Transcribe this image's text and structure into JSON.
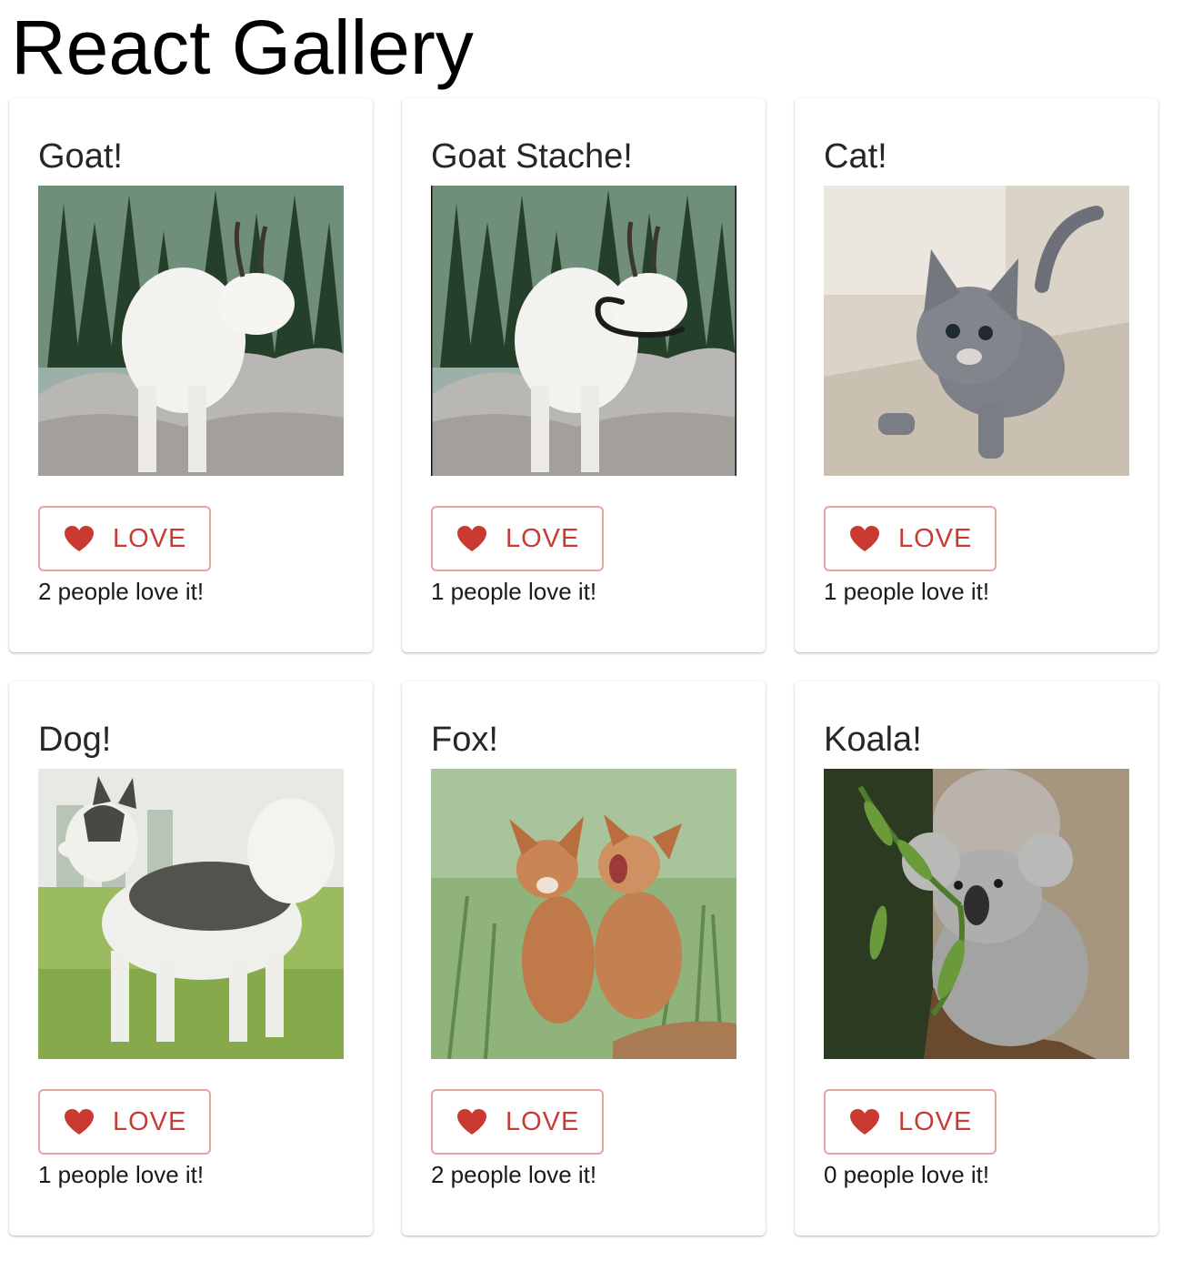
{
  "app": {
    "title": "React Gallery"
  },
  "theme": {
    "accent": "#c93a32",
    "button_border": "#e4a5a3"
  },
  "cards": [
    {
      "title": "Goat!",
      "image": "mountain-goat-photo",
      "button_label": "LOVE",
      "count_text": "2 people love it!",
      "loves": 2
    },
    {
      "title": "Goat Stache!",
      "image": "mountain-goat-with-mustache-photo",
      "button_label": "LOVE",
      "count_text": "1 people love it!",
      "loves": 1
    },
    {
      "title": "Cat!",
      "image": "gray-kitten-photo",
      "button_label": "LOVE",
      "count_text": "1 people love it!",
      "loves": 1
    },
    {
      "title": "Dog!",
      "image": "husky-dog-photo",
      "button_label": "LOVE",
      "count_text": "1 people love it!",
      "loves": 1
    },
    {
      "title": "Fox!",
      "image": "fox-kits-photo",
      "button_label": "LOVE",
      "count_text": "2 people love it!",
      "loves": 2
    },
    {
      "title": "Koala!",
      "image": "koala-photo",
      "button_label": "LOVE",
      "count_text": "0 people love it!",
      "loves": 0
    }
  ]
}
